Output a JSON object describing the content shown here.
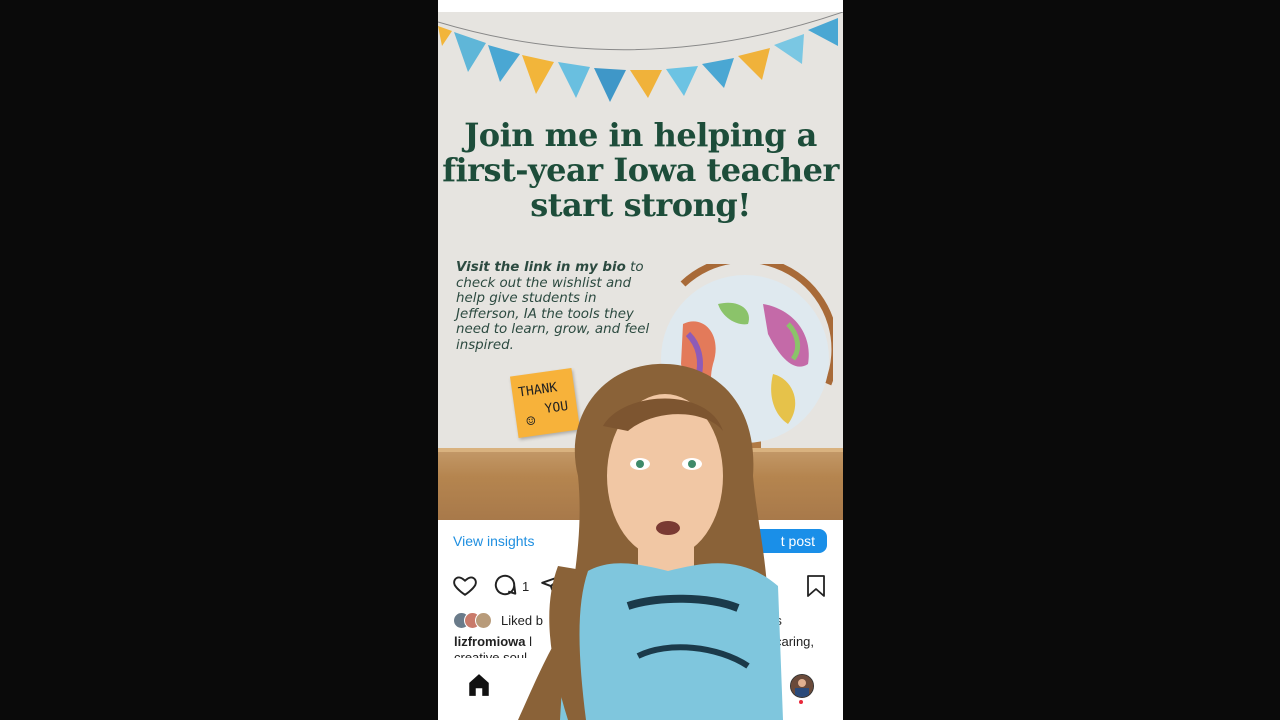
{
  "post": {
    "headline_lines": [
      "Join me in helping a",
      "first-year Iowa teacher",
      "start strong!"
    ],
    "body_bold": "Visit the link in my bio",
    "body_rest": " to check out the wishlist and help give students in Jefferson, IA the tools they need to learn, grow, and feel inspired.",
    "sticky_line1": "THANK",
    "sticky_line2": "YOU",
    "sticky_face": "☺"
  },
  "insights": {
    "view_insights_label": "View insights",
    "boost_label": "t post"
  },
  "actions": {
    "comment_count": "1"
  },
  "liked": {
    "prefix": "Liked b",
    "suffix": "rs"
  },
  "caption": {
    "username": "lizfromiowa",
    "text_start": " l",
    "text_end": "caring,",
    "line2": "creative soul"
  },
  "colors": {
    "headline": "#1d4d3a",
    "accent_blue": "#1a8fe8",
    "link_blue": "#1f8fe0",
    "notification": "#e8283b"
  },
  "icons": [
    "heart-icon",
    "comment-icon",
    "share-icon",
    "bookmark-icon",
    "home-icon",
    "profile-avatar"
  ]
}
